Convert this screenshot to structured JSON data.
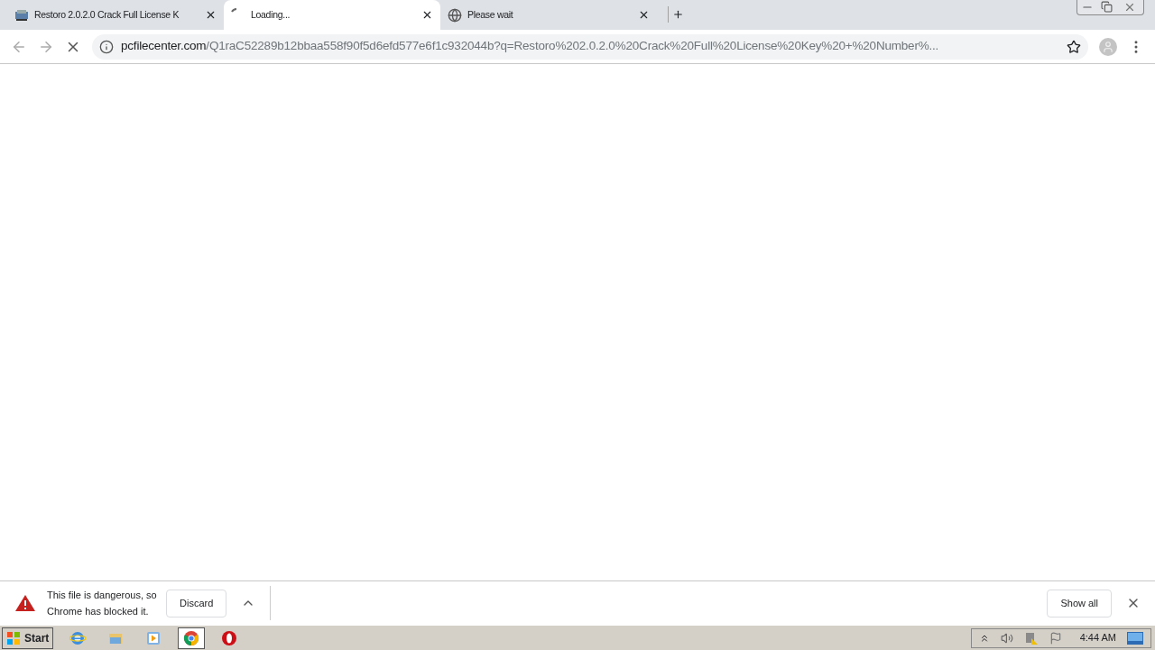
{
  "tabs": [
    {
      "title": "Restoro 2.0.2.0 Crack Full License K",
      "kind": "app",
      "selected": false
    },
    {
      "title": "Loading...",
      "kind": "loading",
      "selected": true
    },
    {
      "title": "Please wait",
      "kind": "globe",
      "selected": false
    }
  ],
  "address_bar": {
    "host": "pcfilecenter.com",
    "path": "/Q1raC52289b12bbaa558f90f5d6efd577e6f1c932044b?q=Restoro%202.0.2.0%20Crack%20Full%20License%20Key%20+%20Number%..."
  },
  "download_bar": {
    "message": "This file is dangerous, so Chrome has blocked it.",
    "discard": "Discard",
    "show_all": "Show all"
  },
  "taskbar": {
    "start": "Start",
    "apps": [
      {
        "kind": "ie",
        "selected": false
      },
      {
        "kind": "explorer",
        "selected": false
      },
      {
        "kind": "media",
        "selected": false
      },
      {
        "kind": "chrome",
        "selected": true
      },
      {
        "kind": "opera",
        "selected": false
      }
    ],
    "clock": "4:44 AM"
  }
}
